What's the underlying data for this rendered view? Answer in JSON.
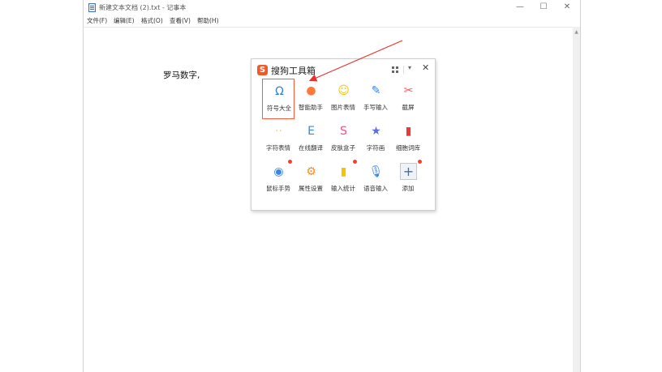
{
  "window": {
    "title": "新建文本文档 (2).txt - 记事本",
    "controls": {
      "minimize": "—",
      "maximize": "☐",
      "close": "✕"
    }
  },
  "menubar": [
    {
      "label": "文件(F)"
    },
    {
      "label": "编辑(E)"
    },
    {
      "label": "格式(O)"
    },
    {
      "label": "查看(V)"
    },
    {
      "label": "帮助(H)"
    }
  ],
  "document": {
    "text": "罗马数字,"
  },
  "toolbox": {
    "logo": "S",
    "title": "搜狗工具箱",
    "down_glyph": "▾",
    "close_glyph": "✕",
    "tools": [
      {
        "label": "符号大全",
        "icon": "omega-symbol-icon",
        "glyph": "Ω",
        "color": "#2f7fe8",
        "selected": true,
        "dot": false
      },
      {
        "label": "智能助手",
        "icon": "assistant-robot-icon",
        "glyph": "●",
        "color": "#ff7a3a",
        "selected": false,
        "dot": false
      },
      {
        "label": "图片表情",
        "icon": "smiley-face-icon",
        "glyph": "☺",
        "color": "#f5c400",
        "selected": false,
        "dot": false
      },
      {
        "label": "手写输入",
        "icon": "pencil-icon",
        "glyph": "✎",
        "color": "#3a86e8",
        "selected": false,
        "dot": false
      },
      {
        "label": "截屏",
        "icon": "scissors-icon",
        "glyph": "✂",
        "color": "#f05a5a",
        "selected": false,
        "dot": false
      },
      {
        "label": "字符表情",
        "icon": "text-emoticon-icon",
        "glyph": "··",
        "color": "#ffd23f",
        "selected": false,
        "dot": false
      },
      {
        "label": "在线翻译",
        "icon": "translate-globe-icon",
        "glyph": "E",
        "color": "#3a86e8",
        "selected": false,
        "dot": false
      },
      {
        "label": "皮肤盒子",
        "icon": "skin-shirt-icon",
        "glyph": "S",
        "color": "#f0508c",
        "selected": false,
        "dot": false
      },
      {
        "label": "字符画",
        "icon": "star-face-icon",
        "glyph": "★",
        "color": "#5a6de8",
        "selected": false,
        "dot": false
      },
      {
        "label": "细胞词库",
        "icon": "lexicon-book-icon",
        "glyph": "▮",
        "color": "#e83a3a",
        "selected": false,
        "dot": false
      },
      {
        "label": "鼠标手势",
        "icon": "mouse-gesture-icon",
        "glyph": "◉",
        "color": "#3a86e8",
        "selected": false,
        "dot": true
      },
      {
        "label": "属性设置",
        "icon": "settings-gear-icon",
        "glyph": "⚙",
        "color": "#ff8a1f",
        "selected": false,
        "dot": false
      },
      {
        "label": "输入统计",
        "icon": "bar-stats-icon",
        "glyph": "▮",
        "color": "#f5c400",
        "selected": false,
        "dot": true
      },
      {
        "label": "语音输入",
        "icon": "microphone-icon",
        "glyph": "🎙",
        "color": "#3a86e8",
        "selected": false,
        "dot": false
      },
      {
        "label": "添加",
        "icon": "plus-add-icon",
        "glyph": "+",
        "color": "#3a6fb0",
        "selected": false,
        "dot": true
      }
    ]
  }
}
